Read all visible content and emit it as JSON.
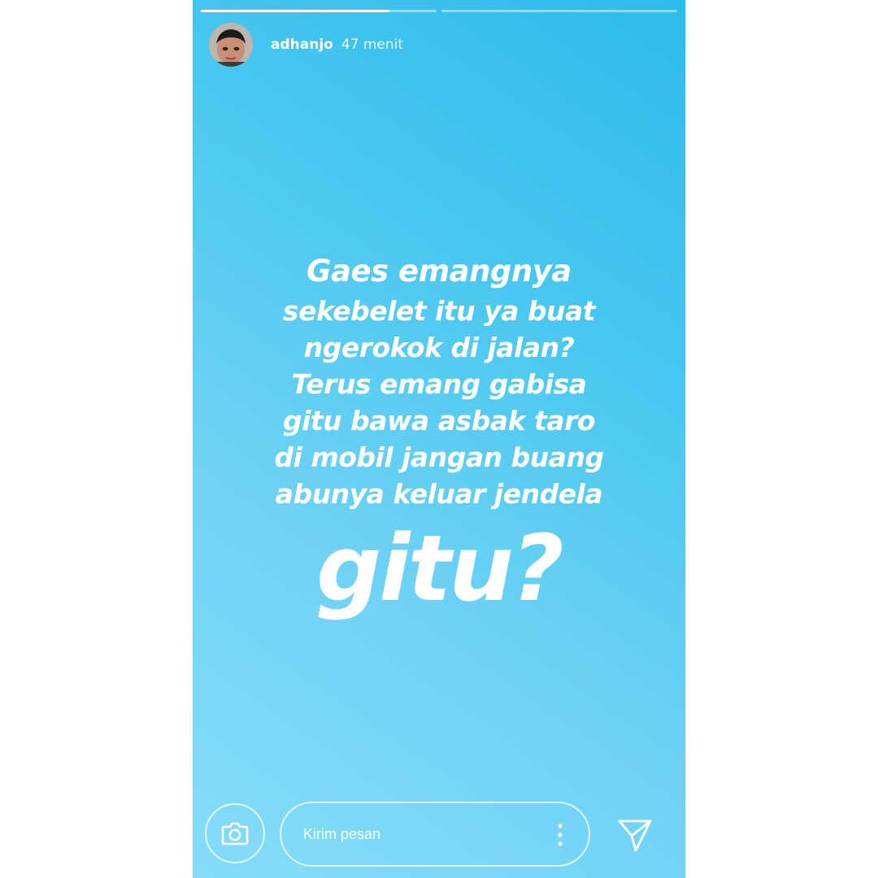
{
  "story": {
    "username": "adhanjo",
    "time": "47 menit",
    "progress": [
      0.8,
      0.0
    ]
  },
  "message": {
    "lines": [
      "Gaes emangnya",
      "sekebelet itu ya buat",
      "ngerokok di jalan?",
      "Terus emang gabisa",
      "gitu bawa asbak taro",
      "di mobil jangan buang",
      "abunya keluar jendela"
    ],
    "emphasis": "gitu?"
  },
  "reply": {
    "placeholder": "Kirim pesan"
  },
  "icons": {
    "camera": "camera-icon",
    "more": "more-vertical-icon",
    "send": "send-icon"
  },
  "colors": {
    "text": "#ffffff",
    "bg_light": "#86dcf8",
    "bg_dark": "#2dbbe9"
  }
}
